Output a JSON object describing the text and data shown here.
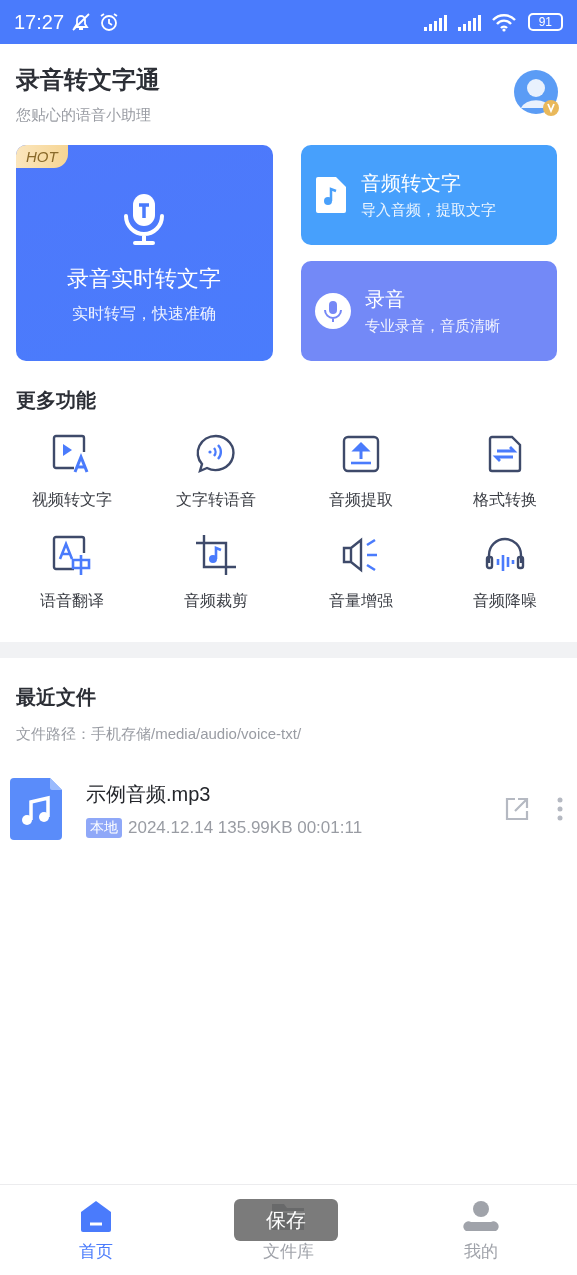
{
  "status_bar": {
    "time": "17:27",
    "battery": "91"
  },
  "header": {
    "title": "录音转文字通",
    "subtitle": "您贴心的语音小助理"
  },
  "main_card": {
    "badge": "HOT",
    "title": "录音实时转文字",
    "subtitle": "实时转写，快速准确"
  },
  "side_cards": [
    {
      "title": "音频转文字",
      "subtitle": "导入音频，提取文字"
    },
    {
      "title": "录音",
      "subtitle": "专业录音，音质清晰"
    }
  ],
  "more": {
    "title": "更多功能",
    "items": [
      {
        "label": "视频转文字"
      },
      {
        "label": "文字转语音"
      },
      {
        "label": "音频提取"
      },
      {
        "label": "格式转换"
      },
      {
        "label": "语音翻译"
      },
      {
        "label": "音频裁剪"
      },
      {
        "label": "音量增强"
      },
      {
        "label": "音频降噪"
      }
    ]
  },
  "recent": {
    "title": "最近文件",
    "path": "文件路径：手机存储/media/audio/voice-txt/",
    "files": [
      {
        "name": "示例音频.mp3",
        "tag": "本地",
        "meta": "2024.12.14 135.99KB 00:01:11"
      }
    ]
  },
  "tab_bar": [
    {
      "label": "首页",
      "selected": true
    },
    {
      "label": "文件库",
      "selected": false
    },
    {
      "label": "我的",
      "selected": false
    }
  ],
  "toast": "保存"
}
